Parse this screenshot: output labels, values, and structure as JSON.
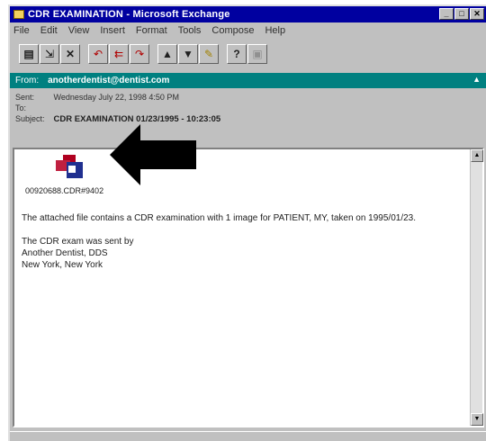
{
  "window": {
    "title": "CDR EXAMINATION - Microsoft Exchange"
  },
  "window_controls": {
    "minimize": "_",
    "maximize": "□",
    "close": "✕"
  },
  "menu": [
    "File",
    "Edit",
    "View",
    "Insert",
    "Format",
    "Tools",
    "Compose",
    "Help"
  ],
  "toolbar": {
    "icons": [
      "print-icon",
      "move-icon",
      "delete-icon",
      "reply-icon",
      "reply-all-icon",
      "forward-icon",
      "previous-icon",
      "next-icon",
      "address-book-icon",
      "help-icon",
      "properties-icon"
    ]
  },
  "header": {
    "from_label": "From:",
    "from_value": "anotherdentist@dentist.com",
    "sent_label": "Sent:",
    "sent_value": "Wednesday July 22, 1998 4:50 PM",
    "to_label": "To:",
    "to_value": "",
    "subject_label": "Subject:",
    "subject_value": "CDR EXAMINATION 01/23/1995 - 10:23:05"
  },
  "attachment": {
    "label": "00920688.CDR#9402"
  },
  "message": {
    "para1": "The attached file contains a CDR examination with 1 image for PATIENT, MY, taken on 1995/01/23.",
    "para2_line1": "The CDR exam was sent by",
    "para2_line2": "Another Dentist, DDS",
    "para2_line3": "New York, New York"
  },
  "colors": {
    "titlebar": "#0000a0",
    "from_bar": "#008080",
    "chrome": "#c0c0c0"
  }
}
